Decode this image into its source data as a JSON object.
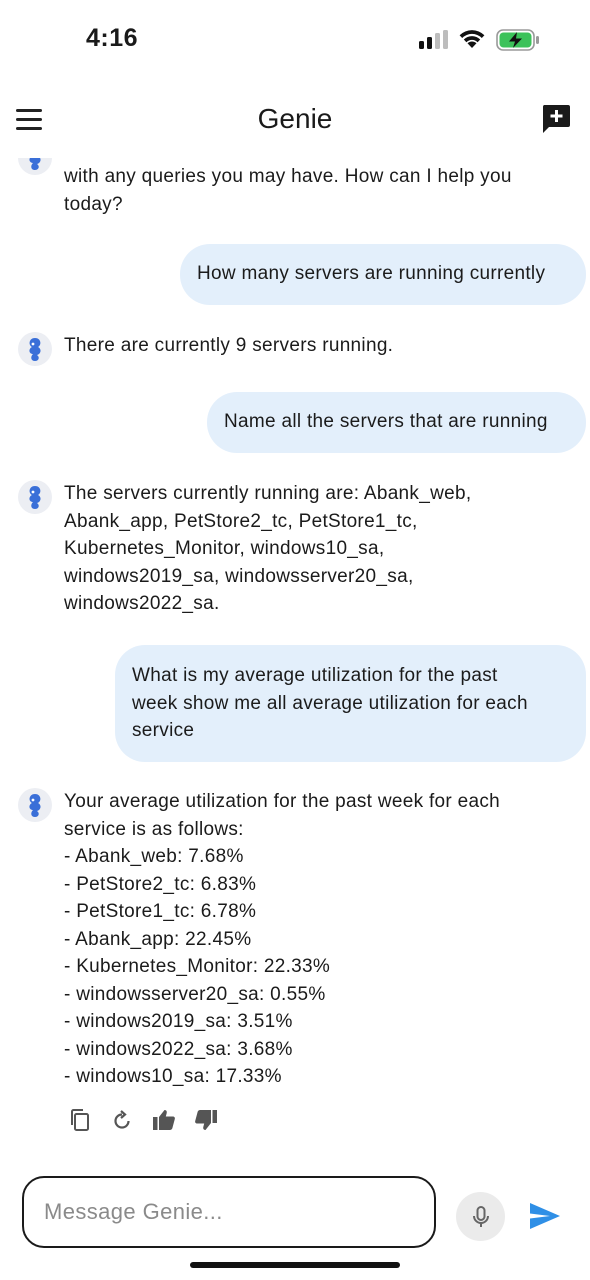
{
  "status_bar": {
    "time": "4:16"
  },
  "header": {
    "title": "Genie"
  },
  "messages": [
    {
      "role": "bot",
      "lines": [
        "with any queries you may have. How can I help you",
        "today?"
      ]
    },
    {
      "role": "user",
      "lines": [
        "How many servers are running currently"
      ]
    },
    {
      "role": "bot",
      "lines": [
        "There are currently 9 servers running."
      ]
    },
    {
      "role": "user",
      "lines": [
        "Name all the servers that are running"
      ]
    },
    {
      "role": "bot",
      "lines": [
        "The servers currently running are: Abank_web,",
        "Abank_app, PetStore2_tc, PetStore1_tc,",
        "Kubernetes_Monitor, windows10_sa,",
        "windows2019_sa, windowsserver20_sa,",
        "windows2022_sa."
      ]
    },
    {
      "role": "user",
      "lines": [
        "What is my average utilization for the past",
        "week show me all average utilization for each",
        "service"
      ]
    },
    {
      "role": "bot",
      "lines": [
        "Your average utilization for the past week for each",
        "service is as follows:",
        "- Abank_web: 7.68%",
        "- PetStore2_tc: 6.83%",
        "- PetStore1_tc: 6.78%",
        "- Abank_app: 22.45%",
        "- Kubernetes_Monitor: 22.33%",
        "- windowsserver20_sa: 0.55%",
        "- windows2019_sa: 3.51%",
        "- windows2022_sa: 3.68%",
        "- windows10_sa: 17.33%"
      ]
    }
  ],
  "message_actions": [
    {
      "name": "copy-icon"
    },
    {
      "name": "regenerate-icon"
    },
    {
      "name": "thumbs-up-icon"
    },
    {
      "name": "thumbs-down-icon"
    }
  ],
  "composer": {
    "placeholder": "Message Genie...",
    "value": ""
  },
  "colors": {
    "user_bubble": "#e3effb",
    "send_accent": "#2f8fe6",
    "text": "#1b1b1b",
    "battery_charging": "#3cc25a"
  }
}
